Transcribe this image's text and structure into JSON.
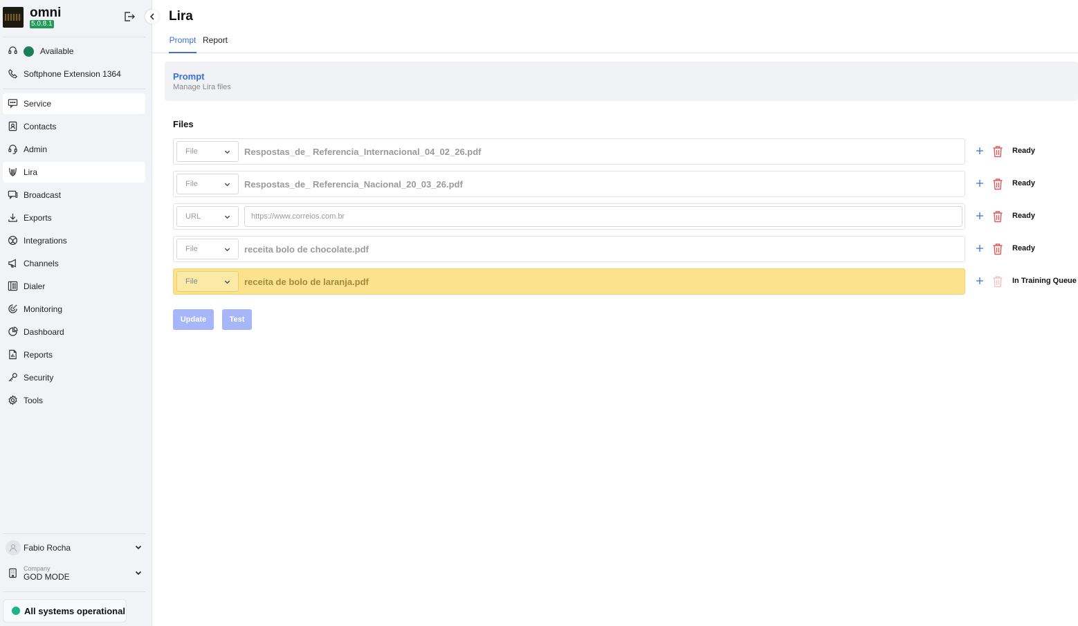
{
  "app": {
    "name": "omni",
    "version": "5.0.8.1"
  },
  "presence": {
    "status": "Available",
    "softphone": "Softphone Extension 1364"
  },
  "sidebar": {
    "items": [
      {
        "label": "Service",
        "icon": "chat-icon"
      },
      {
        "label": "Contacts",
        "icon": "contacts-icon"
      },
      {
        "label": "Admin",
        "icon": "headset-icon"
      },
      {
        "label": "Lira",
        "icon": "lira-icon"
      },
      {
        "label": "Broadcast",
        "icon": "broadcast-icon"
      },
      {
        "label": "Exports",
        "icon": "download-icon"
      },
      {
        "label": "Integrations",
        "icon": "integrations-icon"
      },
      {
        "label": "Channels",
        "icon": "megaphone-icon"
      },
      {
        "label": "Dialer",
        "icon": "dialer-icon"
      },
      {
        "label": "Monitoring",
        "icon": "monitoring-icon"
      },
      {
        "label": "Dashboard",
        "icon": "pie-chart-icon"
      },
      {
        "label": "Reports",
        "icon": "report-icon"
      },
      {
        "label": "Security",
        "icon": "key-icon"
      },
      {
        "label": "Tools",
        "icon": "gear-icon"
      }
    ]
  },
  "user": {
    "name": "Fabio Rocha"
  },
  "company": {
    "label": "Company",
    "value": "GOD MODE"
  },
  "system_status": "All systems operational",
  "page": {
    "title": "Lira",
    "tabs": [
      "Prompt",
      "Report"
    ],
    "section_title": "Prompt",
    "section_subtitle": "Manage Lira files",
    "files_label": "Files"
  },
  "files": [
    {
      "type": "File",
      "value": "Respostas_de_ Referencia_Internacional_04_02_26.pdf",
      "status": "Ready"
    },
    {
      "type": "File",
      "value": "Respostas_de_ Referencia_Nacional_20_03_26.pdf",
      "status": "Ready"
    },
    {
      "type": "URL",
      "placeholder": "https://www.correios.com.br",
      "value": "",
      "status": "Ready"
    },
    {
      "type": "File",
      "value": "receita bolo de chocolate.pdf",
      "status": "Ready"
    },
    {
      "type": "File",
      "value": "receita de bolo de laranja.pdf",
      "status": "In Training Queue"
    }
  ],
  "buttons": {
    "update": "Update",
    "test": "Test"
  },
  "colors": {
    "accent": "#3b6fd8",
    "available": "#1a7f5a",
    "highlight": "#fbe38e",
    "delete": "#e05a5a",
    "version_badge": "#1f9d55"
  }
}
